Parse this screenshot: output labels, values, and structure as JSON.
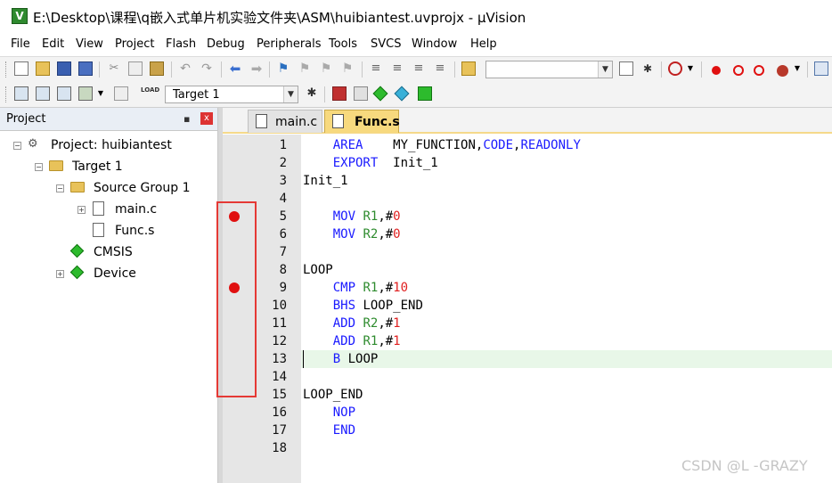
{
  "window": {
    "title": "E:\\Desktop\\课程\\q嵌入式单片机实验文件夹\\ASM\\huibiantest.uvprojx - µVision",
    "app_icon_text": "V"
  },
  "menu": [
    "File",
    "Edit",
    "View",
    "Project",
    "Flash",
    "Debug",
    "Peripherals",
    "Tools",
    "SVCS",
    "Window",
    "Help"
  ],
  "toolbar2": {
    "target_select": "Target 1"
  },
  "project_panel": {
    "title": "Project",
    "pin_glyph": "ꟷ",
    "close_glyph": "x",
    "project_label": "Project: huibiantest",
    "target_label": "Target 1",
    "group_label": "Source Group 1",
    "file1": "main.c",
    "file2": "Func.s",
    "cmsis": "CMSIS",
    "device": "Device"
  },
  "tabs": [
    {
      "label": "main.c",
      "active": false
    },
    {
      "label": "Func.s",
      "active": true
    }
  ],
  "editor": {
    "lines": [
      {
        "n": "1",
        "bp": false
      },
      {
        "n": "2",
        "bp": false
      },
      {
        "n": "3",
        "bp": false
      },
      {
        "n": "4",
        "bp": false
      },
      {
        "n": "5",
        "bp": true
      },
      {
        "n": "6",
        "bp": false
      },
      {
        "n": "7",
        "bp": false
      },
      {
        "n": "8",
        "bp": false
      },
      {
        "n": "9",
        "bp": true
      },
      {
        "n": "10",
        "bp": false
      },
      {
        "n": "11",
        "bp": false
      },
      {
        "n": "12",
        "bp": false
      },
      {
        "n": "13",
        "bp": true
      },
      {
        "n": "14",
        "bp": false
      },
      {
        "n": "15",
        "bp": false
      },
      {
        "n": "16",
        "bp": false
      },
      {
        "n": "17",
        "bp": false
      },
      {
        "n": "18",
        "bp": false
      }
    ],
    "code": {
      "l1_kw": "AREA",
      "l1_rest": "MY_FUNCTION,",
      "l1_kw2": "CODE",
      "l1_comma": ",",
      "l1_kw3": "READONLY",
      "l2_kw": "EXPORT",
      "l2_rest": "Init_1",
      "l3": "Init_1",
      "l5_kw": "MOV",
      "l5_reg": "R1",
      "l5_comma": ",#",
      "l5_num": "0",
      "l6_kw": "MOV",
      "l6_reg": "R2",
      "l6_comma": ",#",
      "l6_num": "0",
      "l8": "LOOP",
      "l9_kw": "CMP",
      "l9_reg": "R1",
      "l9_comma": ",#",
      "l9_num": "10",
      "l10_kw": "BHS",
      "l10_rest": "LOOP_END",
      "l11_kw": "ADD",
      "l11_reg": "R2",
      "l11_comma": ",#",
      "l11_num": "1",
      "l12_kw": "ADD",
      "l12_reg": "R1",
      "l12_comma": ",#",
      "l12_num": "1",
      "l13_kw": "B",
      "l13_rest": "LOOP",
      "l15": "LOOP_END",
      "l16_kw": "NOP",
      "l17_kw": "END"
    }
  },
  "watermark": "CSDN @L -GRAZY",
  "colors": {
    "keyword": "#1a1aff",
    "register": "#2e8b2e",
    "number": "#e02020",
    "breakpoint": "#e01010",
    "active_tab": "#f7d97e",
    "annotation_box": "#e53935"
  }
}
